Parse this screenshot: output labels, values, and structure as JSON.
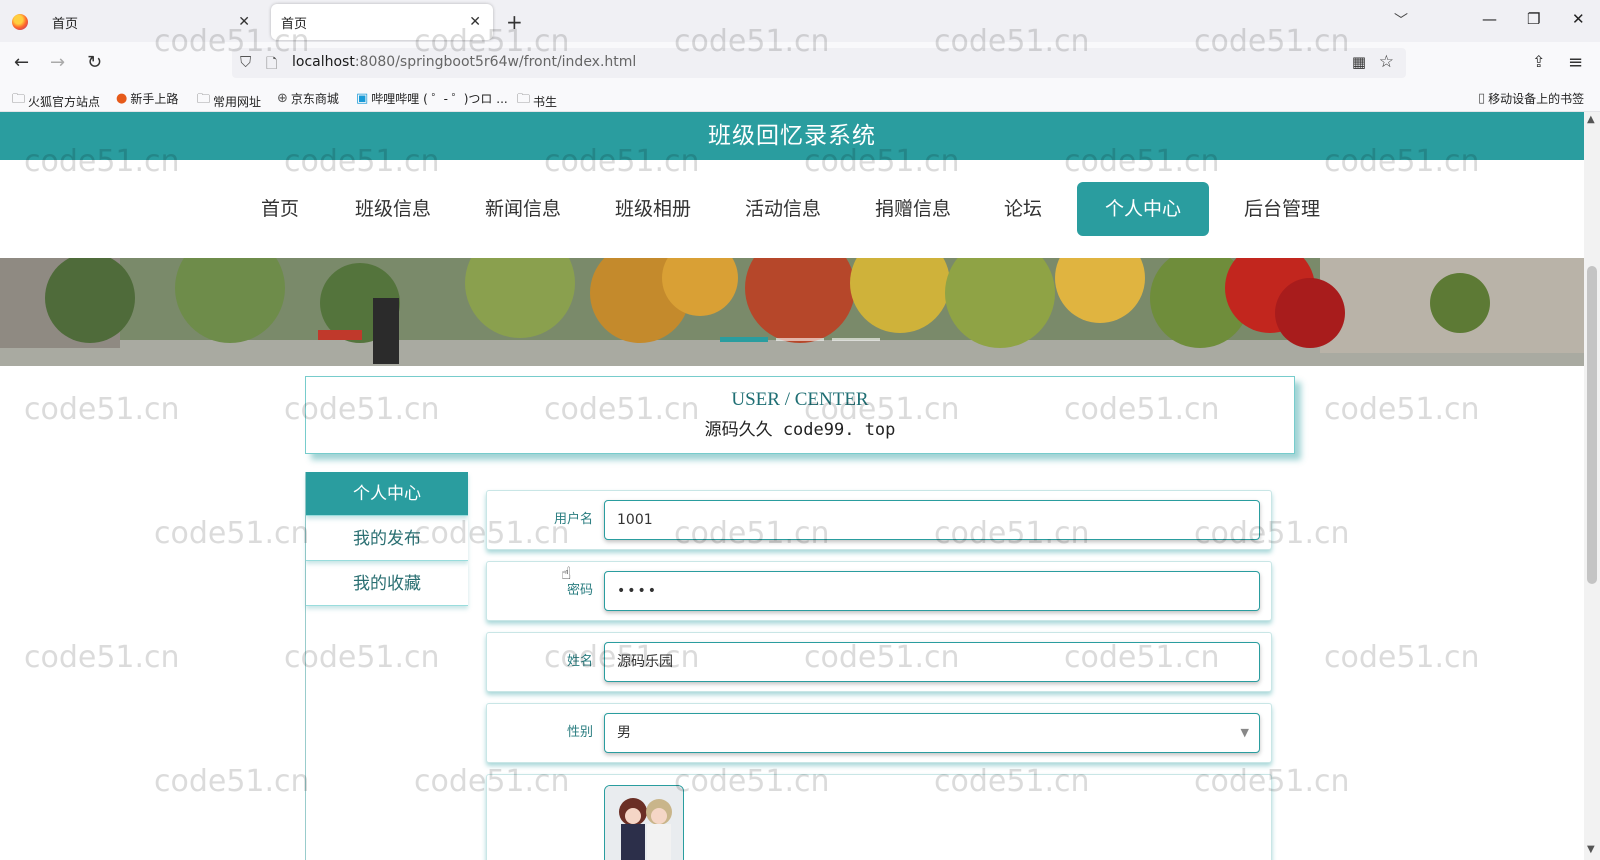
{
  "browser": {
    "tabs": [
      {
        "title": "首页",
        "active": false
      },
      {
        "title": "首页",
        "active": true
      }
    ],
    "url_host": "localhost",
    "url_path": ":8080/springboot5r64w/front/index.html",
    "bookmarks": [
      "火狐官方站点",
      "新手上路",
      "常用网址",
      "京东商城",
      "哔哩哔哩 ( ゜- ゜)つロ ...",
      "书生"
    ],
    "mobile_bookmarks": "移动设备上的书签"
  },
  "site": {
    "title": "班级回忆录系统",
    "nav": [
      "首页",
      "班级信息",
      "新闻信息",
      "班级相册",
      "活动信息",
      "捐赠信息",
      "论坛",
      "个人中心",
      "后台管理"
    ],
    "active_nav": "个人中心",
    "accent_color": "#2a9d9f"
  },
  "section": {
    "title_en": "USER / CENTER",
    "subtitle": "源码久久 code99. top"
  },
  "sidebar": {
    "items": [
      "个人中心",
      "我的发布",
      "我的收藏"
    ],
    "active": "个人中心"
  },
  "form": {
    "username_label": "用户名",
    "username_value": "1001",
    "password_label": "密码",
    "password_value": "••••",
    "name_label": "姓名",
    "name_value": "源码乐园",
    "gender_label": "性别",
    "gender_value": "男"
  },
  "watermark": "code51.cn"
}
